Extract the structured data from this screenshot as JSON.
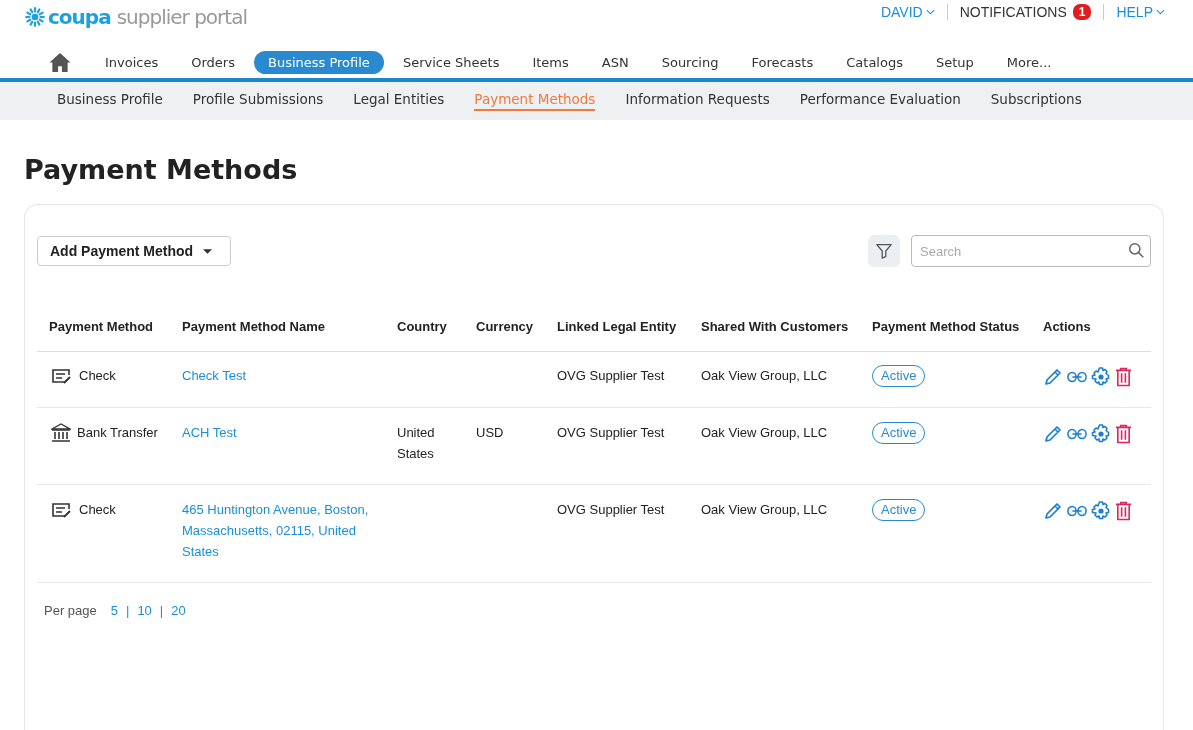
{
  "header": {
    "logo_brand": "coupa",
    "logo_product": "supplier portal",
    "user_menu": "DAVID",
    "notifications": {
      "label": "NOTIFICATIONS",
      "count": "1"
    },
    "help_menu": "HELP"
  },
  "main_nav": [
    {
      "label": "Invoices",
      "selected": false
    },
    {
      "label": "Orders",
      "selected": false
    },
    {
      "label": "Business Profile",
      "selected": true
    },
    {
      "label": "Service Sheets",
      "selected": false
    },
    {
      "label": "Items",
      "selected": false
    },
    {
      "label": "ASN",
      "selected": false
    },
    {
      "label": "Sourcing",
      "selected": false
    },
    {
      "label": "Forecasts",
      "selected": false
    },
    {
      "label": "Catalogs",
      "selected": false
    },
    {
      "label": "Setup",
      "selected": false
    },
    {
      "label": "More...",
      "selected": false
    }
  ],
  "sub_nav": [
    {
      "label": "Business Profile",
      "selected": false
    },
    {
      "label": "Profile Submissions",
      "selected": false
    },
    {
      "label": "Legal Entities",
      "selected": false
    },
    {
      "label": "Payment Methods",
      "selected": true
    },
    {
      "label": "Information Requests",
      "selected": false
    },
    {
      "label": "Performance Evaluation",
      "selected": false
    },
    {
      "label": "Subscriptions",
      "selected": false
    }
  ],
  "page_title": "Payment Methods",
  "toolbar": {
    "add_button": "Add Payment Method",
    "search": {
      "placeholder": "Search"
    }
  },
  "table": {
    "columns": [
      "Payment Method",
      "Payment Method Name",
      "Country",
      "Currency",
      "Linked Legal Entity",
      "Shared With Customers",
      "Payment Method Status",
      "Actions"
    ],
    "rows": [
      {
        "kind": "check",
        "method": "Check",
        "name": "Check Test",
        "country": "",
        "currency": "",
        "legal_entity": "OVG Supplier Test",
        "shared_with": "Oak View Group, LLC",
        "status": "Active"
      },
      {
        "kind": "bank",
        "method": "Bank Transfer",
        "name": "ACH Test",
        "country": "United States",
        "currency": "USD",
        "legal_entity": "OVG Supplier Test",
        "shared_with": "Oak View Group, LLC",
        "status": "Active"
      },
      {
        "kind": "check",
        "method": "Check",
        "name": "465 Huntington Avenue, Boston, Massachusetts, 02115, United States",
        "country": "",
        "currency": "",
        "legal_entity": "OVG Supplier Test",
        "shared_with": "Oak View Group, LLC",
        "status": "Active"
      }
    ]
  },
  "pagination": {
    "label": "Per page",
    "separator": "|",
    "options": [
      "5",
      "10",
      "20"
    ]
  }
}
